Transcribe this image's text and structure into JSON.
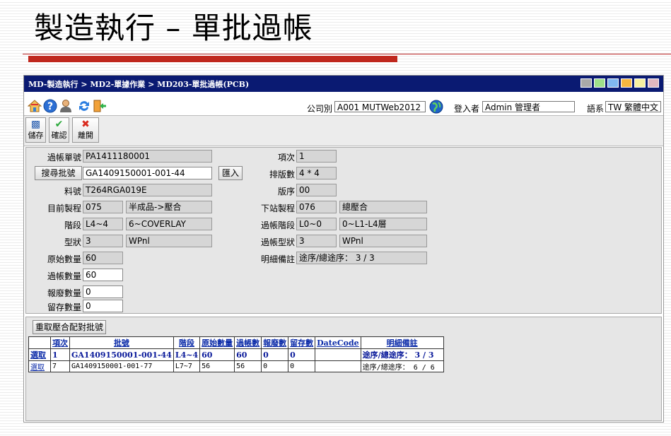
{
  "slide": {
    "title": "製造執行 – 單批過帳"
  },
  "app": {
    "breadcrumb": "MD-製造執行 > MD2-單據作業 > MD203-單批過帳(PCB)",
    "theme_colors": [
      "#a8a8a8",
      "#9ee08a",
      "#7fb8f0",
      "#f5b640",
      "#f7f0a0",
      "#e0b8c0"
    ]
  },
  "info": {
    "company_label": "公司別",
    "company_value": "A001 MUTWeb2012",
    "user_label": "登入者",
    "user_value": "Admin 管理者",
    "language_label": "語系",
    "language_value": "TW 繁體中文"
  },
  "toolbar": {
    "icons": [
      "home-icon",
      "help-icon",
      "user-icon",
      "refresh-icon",
      "exit-icon"
    ],
    "save_label": "儲存",
    "confirm_label": "確認",
    "leave_label": "離開"
  },
  "form": {
    "post_no_label": "過帳單號",
    "post_no": "PA1411180001",
    "search_lot_button": "搜尋批號",
    "lot_no": "GA1409150001-001-44",
    "import_button": "匯入",
    "part_no_label": "料號",
    "part_no": "T264RGA019E",
    "current_process_label": "目前製程",
    "current_process_code": "075",
    "current_process_name": "半成品->壓合",
    "stage_label": "階段",
    "stage_code": "L4~4",
    "stage_name": "6~COVERLAY",
    "type_label": "型狀",
    "type_code": "3",
    "type_name": "WPnl",
    "original_qty_label": "原始數量",
    "original_qty": "60",
    "post_qty_label": "過帳數量",
    "post_qty": "60",
    "scrap_qty_label": "報廢數量",
    "scrap_qty": "0",
    "retain_qty_label": "留存數量",
    "retain_qty": "0",
    "item_label": "項次",
    "item": "1",
    "layout_label": "排版數",
    "layout": "4 * 4",
    "version_label": "版序",
    "version": "00",
    "next_process_label": "下站製程",
    "next_process_code": "076",
    "next_process_name": "總壓合",
    "post_stage_label": "過帳階段",
    "post_stage_code": "L0~0",
    "post_stage_name": "0~L1-L4層",
    "post_type_label": "過帳型狀",
    "post_type_code": "3",
    "post_type_name": "WPnl",
    "detail_note_label": "明細備註",
    "detail_note": "途序/總途序： 3 / 3"
  },
  "grid": {
    "refetch_button": "重取壓合配對批號",
    "columns": [
      "",
      "項次",
      "批號",
      "階段",
      "原始數量",
      "過帳數",
      "報廢數",
      "留存數",
      "DateCode",
      "明細備註"
    ],
    "rows": [
      {
        "pick": "選取",
        "item": "1",
        "lot": "GA1409150001-001-44",
        "stage": "L4~4",
        "orig": "60",
        "post": "60",
        "scrap": "0",
        "retain": "0",
        "datecode": "",
        "note": "途序/總途序： 3 / 3"
      },
      {
        "pick": "選取",
        "item": "7",
        "lot": "GA1409150001-001-77",
        "stage": "L7~7",
        "orig": "56",
        "post": "56",
        "scrap": "0",
        "retain": "0",
        "datecode": "",
        "note": "途序/總途序： 6 / 6"
      }
    ]
  }
}
